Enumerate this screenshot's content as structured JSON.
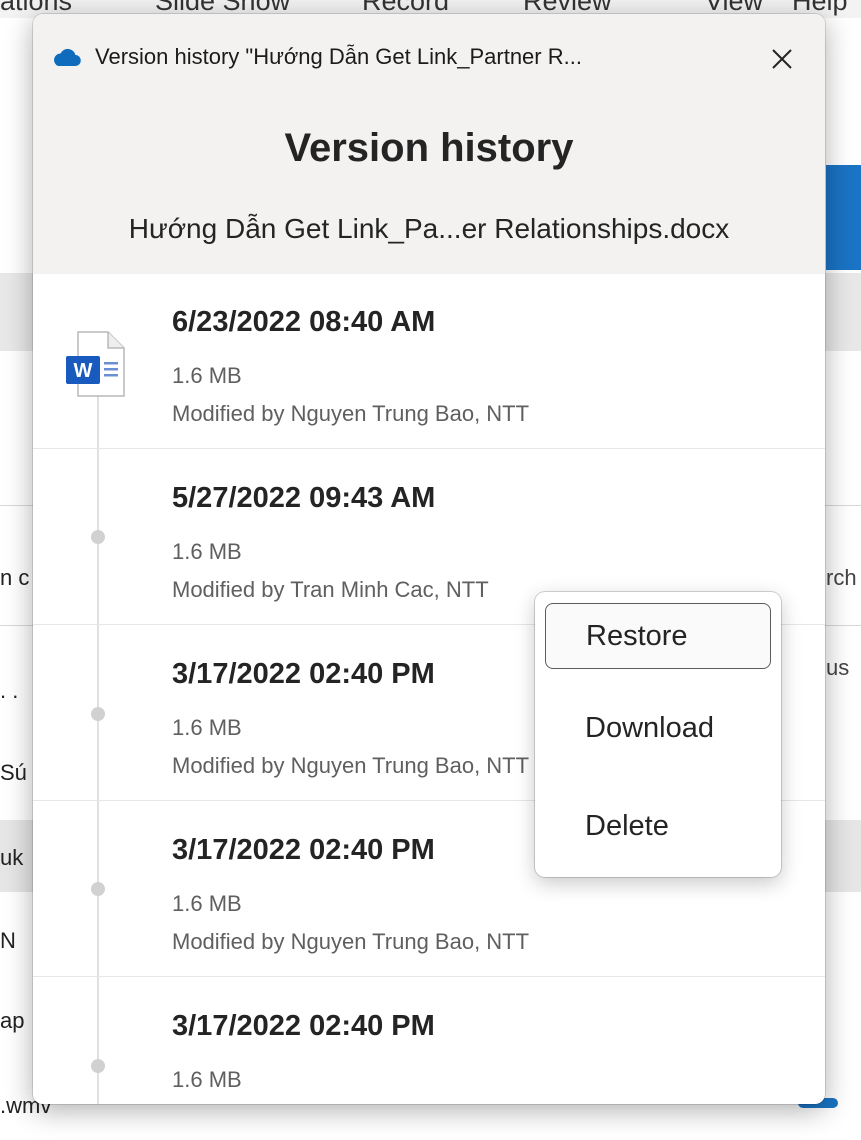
{
  "background": {
    "menu": [
      "ations",
      "Slide Show",
      "Record",
      "Review",
      "View",
      "Help"
    ],
    "left_fragments": [
      "n c",
      ". .",
      "Sú",
      "uk",
      "N",
      "ap",
      ".wmv"
    ],
    "right_fragments": [
      "rch",
      "us"
    ],
    "accent_color": "#1a73c4"
  },
  "window": {
    "title": "Version history \"Hướng Dẫn Get Link_Partner R...",
    "cloud_icon": "onedrive-cloud-icon",
    "close_symbol": "✕",
    "heading": "Version history",
    "filename": "Hướng Dẫn Get Link_Pa...er Relationships.docx",
    "file_icon": "word-document-icon"
  },
  "versions": [
    {
      "date": "6/23/2022 08:40 AM",
      "size": "1.6 MB",
      "modified": "Modified by Nguyen Trung Bao, NTT"
    },
    {
      "date": "5/27/2022 09:43 AM",
      "size": "1.6 MB",
      "modified": "Modified by Tran Minh Cac, NTT"
    },
    {
      "date": "3/17/2022 02:40 PM",
      "size": "1.6 MB",
      "modified": "Modified by Nguyen Trung Bao, NTT"
    },
    {
      "date": "3/17/2022 02:40 PM",
      "size": "1.6 MB",
      "modified": "Modified by Nguyen Trung Bao, NTT"
    },
    {
      "date": "3/17/2022 02:40 PM",
      "size": "1.6 MB",
      "modified": ""
    }
  ],
  "context_menu": {
    "items": [
      "Restore",
      "Download",
      "Delete"
    ],
    "focused": "Restore"
  }
}
